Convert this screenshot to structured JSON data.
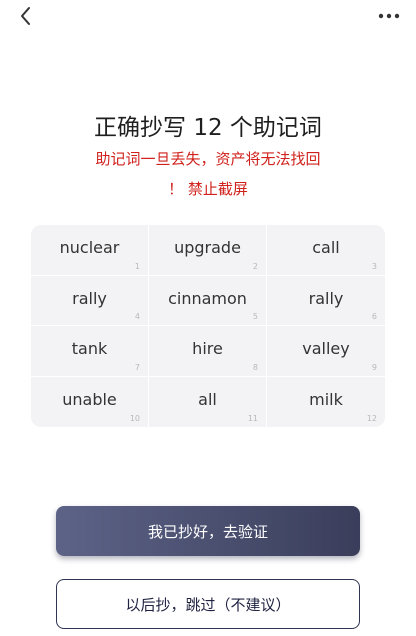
{
  "header": {
    "back_icon": "chevron-left-icon",
    "more_icon": "more-horizontal-icon"
  },
  "main": {
    "title": "正确抄写 12 个助记词",
    "warning_line1": "助记词一旦丢失，资产将无法找回",
    "warning_line2": "！ 禁止截屏",
    "words": [
      {
        "word": "nuclear",
        "index": "1"
      },
      {
        "word": "upgrade",
        "index": "2"
      },
      {
        "word": "call",
        "index": "3"
      },
      {
        "word": "rally",
        "index": "4"
      },
      {
        "word": "cinnamon",
        "index": "5"
      },
      {
        "word": "rally",
        "index": "6"
      },
      {
        "word": "tank",
        "index": "7"
      },
      {
        "word": "hire",
        "index": "8"
      },
      {
        "word": "valley",
        "index": "9"
      },
      {
        "word": "unable",
        "index": "10"
      },
      {
        "word": "all",
        "index": "11"
      },
      {
        "word": "milk",
        "index": "12"
      }
    ]
  },
  "actions": {
    "confirm_label": "我已抄好，去验证",
    "skip_label": "以后抄，跳过（不建议）"
  },
  "colors": {
    "warning": "#d0211c",
    "primary_start": "#5d6387",
    "primary_end": "#3a3e5b",
    "grid_bg": "#f3f3f5"
  }
}
